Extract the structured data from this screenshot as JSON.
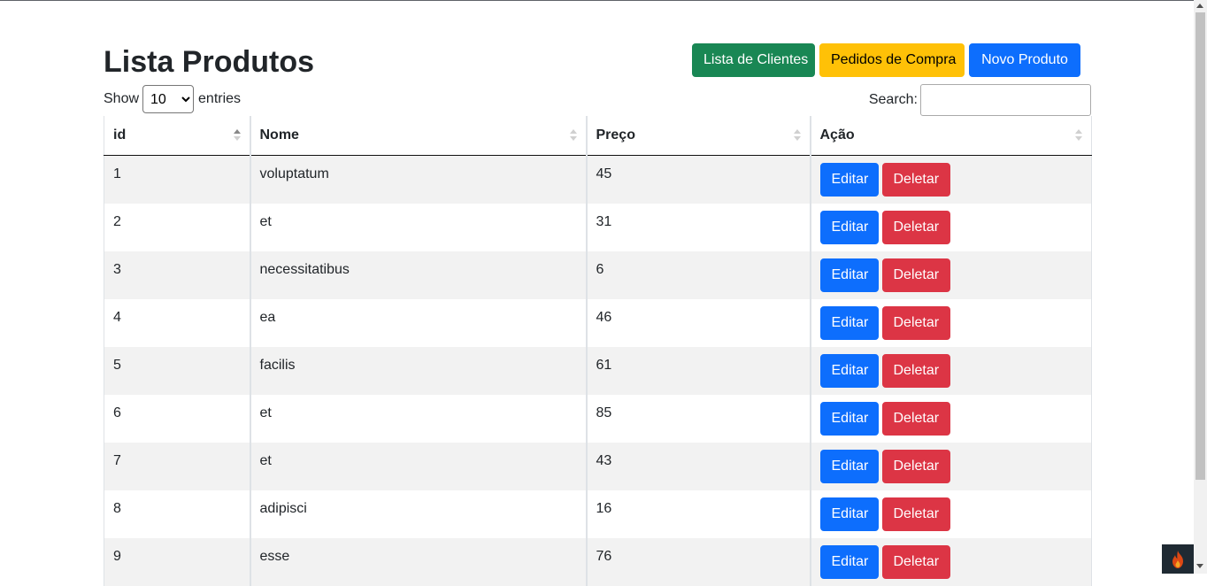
{
  "page": {
    "title": "Lista Produtos"
  },
  "actions": {
    "clients_label": "Lista de Clientes",
    "orders_label": "Pedidos de Compra",
    "new_product_label": "Novo Produto"
  },
  "controls": {
    "show_label": "Show",
    "entries_label": "entries",
    "page_length": "10",
    "search_label": "Search:",
    "search_value": ""
  },
  "table": {
    "columns": [
      "id",
      "Nome",
      "Preço",
      "Ação"
    ],
    "sorted_column": "id",
    "sort_direction": "ascending",
    "edit_label": "Editar",
    "delete_label": "Deletar",
    "rows": [
      {
        "id": "1",
        "nome": "voluptatum",
        "preco": "45"
      },
      {
        "id": "2",
        "nome": "et",
        "preco": "31"
      },
      {
        "id": "3",
        "nome": "necessitatibus",
        "preco": "6"
      },
      {
        "id": "4",
        "nome": "ea",
        "preco": "46"
      },
      {
        "id": "5",
        "nome": "facilis",
        "preco": "61"
      },
      {
        "id": "6",
        "nome": "et",
        "preco": "85"
      },
      {
        "id": "7",
        "nome": "et",
        "preco": "43"
      },
      {
        "id": "8",
        "nome": "adipisci",
        "preco": "16"
      },
      {
        "id": "9",
        "nome": "esse",
        "preco": "76"
      }
    ]
  },
  "colors": {
    "success": "#198754",
    "warning": "#ffc107",
    "primary": "#0d6efd",
    "danger": "#dc3545",
    "stripe": "#f2f2f2"
  },
  "icons": {
    "sort": "sort-arrows-icon",
    "widget": "flame-icon"
  }
}
